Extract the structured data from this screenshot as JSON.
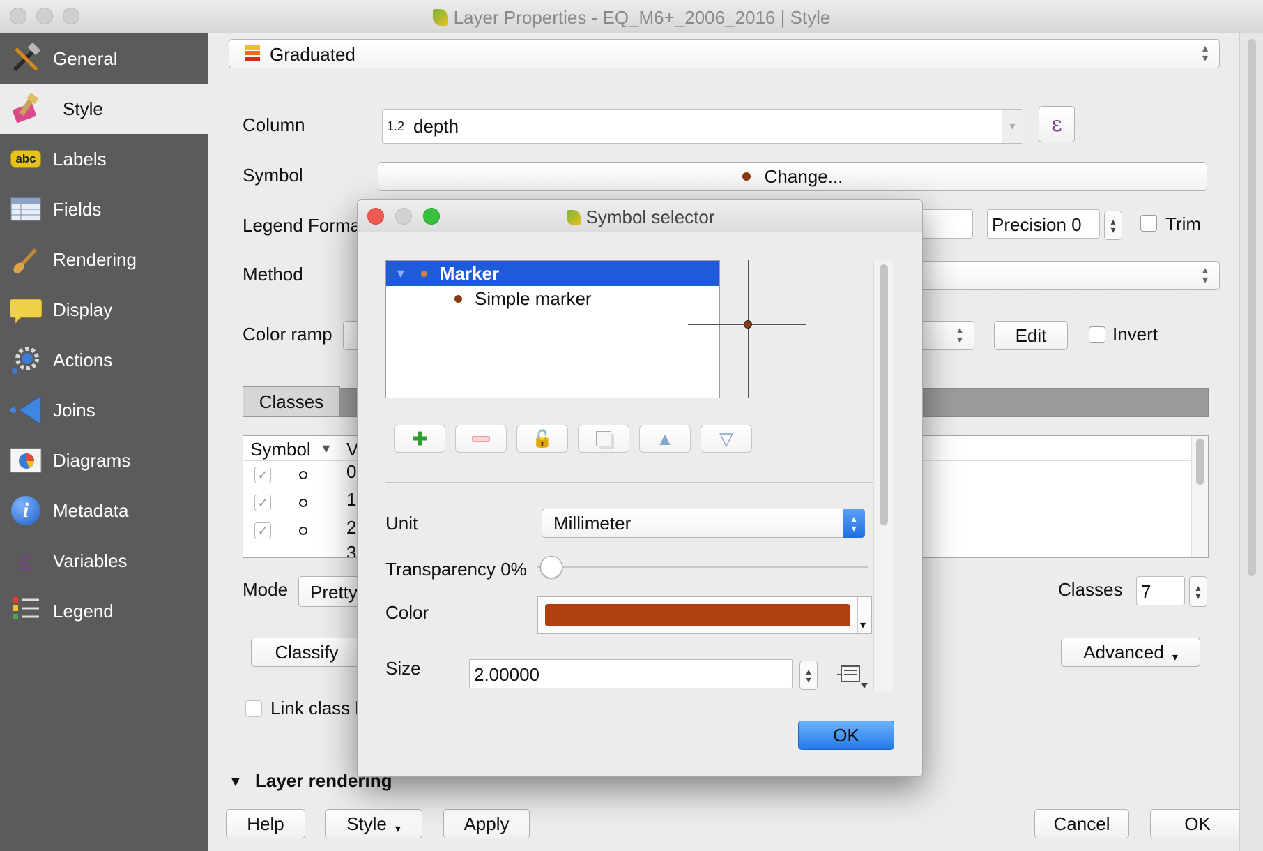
{
  "window": {
    "title": "Layer Properties - EQ_M6+_2006_2016 | Style"
  },
  "sidebar": {
    "items": [
      {
        "label": "General",
        "icon": "hammer-icon",
        "active": false
      },
      {
        "label": "Style",
        "icon": "paintbrush-icon",
        "active": true
      },
      {
        "label": "Labels",
        "icon": "abc-label-icon",
        "active": false
      },
      {
        "label": "Fields",
        "icon": "table-icon",
        "active": false
      },
      {
        "label": "Rendering",
        "icon": "brush-icon",
        "active": false
      },
      {
        "label": "Display",
        "icon": "speech-bubble-icon",
        "active": false
      },
      {
        "label": "Actions",
        "icon": "gear-icon",
        "active": false
      },
      {
        "label": "Joins",
        "icon": "join-arrow-icon",
        "active": false
      },
      {
        "label": "Diagrams",
        "icon": "diagram-icon",
        "active": false
      },
      {
        "label": "Metadata",
        "icon": "info-icon",
        "active": false
      },
      {
        "label": "Variables",
        "icon": "epsilon-icon",
        "active": false
      },
      {
        "label": "Legend",
        "icon": "legend-icon",
        "active": false
      }
    ]
  },
  "style": {
    "renderer": "Graduated",
    "column_label": "Column",
    "column_type": "1.2",
    "column_value": "depth",
    "symbol_label": "Symbol",
    "symbol_button": "Change...",
    "legend_format_label": "Legend Forma",
    "precision_label": "Precision 0",
    "trim_label": "Trim",
    "method_label": "Method",
    "color_ramp_label": "Color ramp",
    "edit_button": "Edit",
    "invert_label": "Invert",
    "classes_tab": "Classes",
    "table_header_symbol": "Symbol",
    "table_header_value": "V",
    "table_rows": [
      "0",
      "1",
      "2",
      "3"
    ],
    "mode_label": "Mode",
    "mode_value": "Pretty",
    "classes_label": "Classes",
    "classes_value": "7",
    "classify_button": "Classify",
    "advanced_button": "Advanced",
    "link_class_label": "Link class l",
    "layer_rendering_label": "Layer rendering"
  },
  "footer": {
    "help": "Help",
    "style": "Style",
    "apply": "Apply",
    "cancel": "Cancel",
    "ok": "OK"
  },
  "dialog": {
    "title": "Symbol selector",
    "tree": [
      {
        "label": "Marker",
        "selected": true
      },
      {
        "label": "Simple marker",
        "selected": false
      }
    ],
    "unit_label": "Unit",
    "unit_value": "Millimeter",
    "transparency_label": "Transparency 0%",
    "transparency_value": 0,
    "color_label": "Color",
    "color_value": "#b03f12",
    "size_label": "Size",
    "size_value": "2.00000",
    "ok_button": "OK"
  },
  "colors": {
    "sidebar_bg": "#5b5b5b",
    "selection_blue": "#1f5ad8",
    "ok_blue": "#2f86f0",
    "marker_color": "#8a3a10"
  }
}
